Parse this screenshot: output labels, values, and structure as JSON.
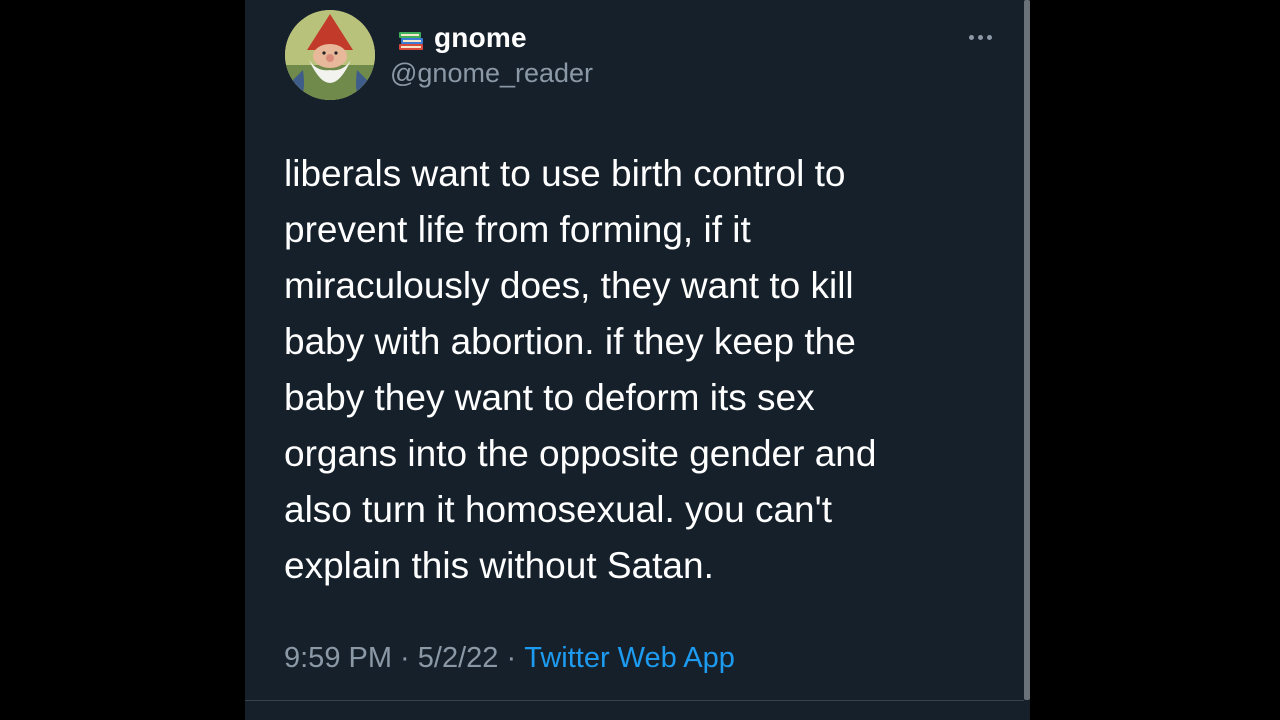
{
  "tweet": {
    "author": {
      "display_name": "gnome",
      "handle": "@gnome_reader",
      "name_emoji_icon": "books-icon",
      "avatar_icon": "gnome-avatar"
    },
    "more_icon": "more-horizontal-icon",
    "text": "liberals want to use birth control to\nprevent life from forming, if it\nmiraculously does, they want to kill\nbaby with abortion.  if they keep the\nbaby they want to deform its sex\norgans into the opposite gender and\nalso turn it homosexual.  you can't\nexplain this without Satan.",
    "time": "9:59 PM",
    "separator": " · ",
    "date": "5/2/22",
    "source": "Twitter Web App"
  },
  "colors": {
    "background": "#15202b",
    "letterbox": "#000000",
    "text_primary": "#ffffff",
    "text_secondary": "#8b98a5",
    "link": "#1d9bf0"
  }
}
